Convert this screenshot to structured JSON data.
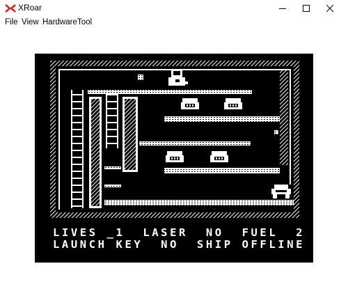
{
  "window": {
    "title": "XRoar",
    "app_icon": "xroar-logo-icon",
    "controls": [
      "minimize-icon",
      "maximize-icon",
      "close-icon"
    ]
  },
  "menubar": {
    "items": [
      "File",
      "View",
      "Hardware",
      "Tool"
    ]
  },
  "game": {
    "status": {
      "line1": "LIVES _1  LASER  NO  FUEL  2",
      "line2": "LAUNCH KEY  NO  SHIP OFFLINE"
    },
    "colors": {
      "background": "#000000",
      "foreground": "#ffffff"
    }
  }
}
